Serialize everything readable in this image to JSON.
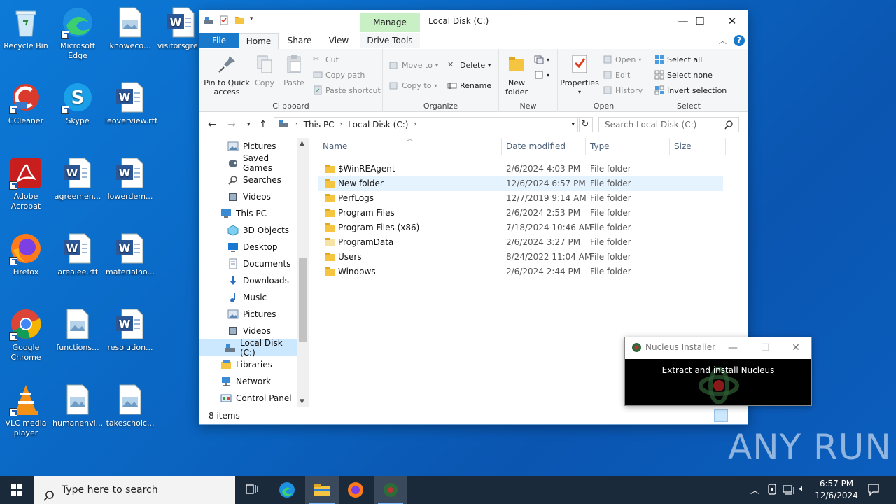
{
  "desktop_icons": [
    {
      "label": "Recycle Bin",
      "icon": "recycle-bin-icon"
    },
    {
      "label": "Microsoft Edge",
      "icon": "edge-icon"
    },
    {
      "label": "knoweco...",
      "icon": "image-file-icon"
    },
    {
      "label": "visitorsgre...",
      "icon": "word-doc-icon"
    },
    {
      "label": "CCleaner",
      "icon": "ccleaner-icon"
    },
    {
      "label": "Skype",
      "icon": "skype-icon"
    },
    {
      "label": "leoverview.rtf",
      "icon": "word-doc-icon"
    },
    {
      "label": "Adobe Acrobat",
      "icon": "acrobat-icon"
    },
    {
      "label": "agreemen...",
      "icon": "word-doc-icon"
    },
    {
      "label": "lowerdem...",
      "icon": "word-doc-icon"
    },
    {
      "label": "Firefox",
      "icon": "firefox-icon"
    },
    {
      "label": "arealee.rtf",
      "icon": "word-doc-icon"
    },
    {
      "label": "materialno...",
      "icon": "word-doc-icon"
    },
    {
      "label": "Google Chrome",
      "icon": "chrome-icon"
    },
    {
      "label": "functions...",
      "icon": "image-file-icon"
    },
    {
      "label": "resolution...",
      "icon": "word-doc-icon"
    },
    {
      "label": "VLC media player",
      "icon": "vlc-icon"
    },
    {
      "label": "humanenvi...",
      "icon": "image-file-icon"
    },
    {
      "label": "takeschoic...",
      "icon": "image-file-icon"
    }
  ],
  "explorer": {
    "title": "Local Disk (C:)",
    "manage_label": "Manage",
    "tabs": {
      "file": "File",
      "home": "Home",
      "share": "Share",
      "view": "View",
      "drive_tools": "Drive Tools"
    },
    "ribbon": {
      "pin_quick_access": "Pin to Quick access",
      "copy": "Copy",
      "paste": "Paste",
      "cut": "Cut",
      "copy_path": "Copy path",
      "paste_shortcut": "Paste shortcut",
      "clipboard": "Clipboard",
      "move_to": "Move to",
      "copy_to": "Copy to",
      "delete": "Delete",
      "rename": "Rename",
      "organize": "Organize",
      "new_folder": "New folder",
      "new": "New",
      "properties": "Properties",
      "open": "Open",
      "edit": "Edit",
      "history": "History",
      "open_group": "Open",
      "select_all": "Select all",
      "select_none": "Select none",
      "invert_selection": "Invert selection",
      "select_group": "Select"
    },
    "address": {
      "crumb1": "This PC",
      "crumb2": "Local Disk (C:)"
    },
    "search_placeholder": "Search Local Disk (C:)",
    "nav_items": [
      {
        "label": "Pictures",
        "icon": "pictures-icon"
      },
      {
        "label": "Saved Games",
        "icon": "saved-games-icon"
      },
      {
        "label": "Searches",
        "icon": "searches-icon"
      },
      {
        "label": "Videos",
        "icon": "videos-icon"
      },
      {
        "label": "This PC",
        "icon": "this-pc-icon"
      },
      {
        "label": "3D Objects",
        "icon": "3d-objects-icon"
      },
      {
        "label": "Desktop",
        "icon": "desktop-icon"
      },
      {
        "label": "Documents",
        "icon": "documents-icon"
      },
      {
        "label": "Downloads",
        "icon": "downloads-icon"
      },
      {
        "label": "Music",
        "icon": "music-icon"
      },
      {
        "label": "Pictures",
        "icon": "pictures-icon"
      },
      {
        "label": "Videos",
        "icon": "videos-icon"
      },
      {
        "label": "Local Disk (C:)",
        "icon": "local-disk-icon"
      },
      {
        "label": "Libraries",
        "icon": "libraries-icon"
      },
      {
        "label": "Network",
        "icon": "network-icon"
      },
      {
        "label": "Control Panel",
        "icon": "control-panel-icon"
      }
    ],
    "columns": {
      "name": "Name",
      "date": "Date modified",
      "type": "Type",
      "size": "Size"
    },
    "files": [
      {
        "name": "$WinREAgent",
        "date": "2/6/2024 4:03 PM",
        "type": "File folder"
      },
      {
        "name": "New folder",
        "date": "12/6/2024 6:57 PM",
        "type": "File folder"
      },
      {
        "name": "PerfLogs",
        "date": "12/7/2019 9:14 AM",
        "type": "File folder"
      },
      {
        "name": "Program Files",
        "date": "2/6/2024 2:53 PM",
        "type": "File folder"
      },
      {
        "name": "Program Files (x86)",
        "date": "7/18/2024 10:46 AM",
        "type": "File folder"
      },
      {
        "name": "ProgramData",
        "date": "2/6/2024 3:27 PM",
        "type": "File folder"
      },
      {
        "name": "Users",
        "date": "8/24/2022 11:04 AM",
        "type": "File folder"
      },
      {
        "name": "Windows",
        "date": "2/6/2024 2:44 PM",
        "type": "File folder"
      }
    ],
    "status_count": "8 items"
  },
  "nucleus": {
    "title": "Nucleus Installer",
    "message": "Extract and install Nucleus"
  },
  "watermark": "ANY RUN",
  "taskbar": {
    "search_placeholder": "Type here to search",
    "time": "6:57 PM",
    "date": "12/6/2024"
  },
  "colors": {
    "accent": "#1979ca",
    "manage_tab": "#c9efc5",
    "selection": "#cce8ff",
    "taskbar": "#1b2a3a"
  }
}
